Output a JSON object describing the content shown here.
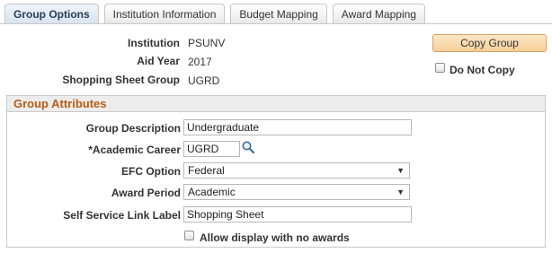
{
  "tabs": [
    {
      "label": "Group Options",
      "active": true
    },
    {
      "label": "Institution Information",
      "active": false
    },
    {
      "label": "Budget Mapping",
      "active": false
    },
    {
      "label": "Award Mapping",
      "active": false
    }
  ],
  "header": {
    "institution_label": "Institution",
    "institution_value": "PSUNV",
    "aid_year_label": "Aid Year",
    "aid_year_value": "2017",
    "shopping_sheet_group_label": "Shopping Sheet Group",
    "shopping_sheet_group_value": "UGRD"
  },
  "actions": {
    "copy_group_label": "Copy Group",
    "do_not_copy_label": "Do Not Copy",
    "do_not_copy_checked": false
  },
  "group_attributes": {
    "title": "Group Attributes",
    "group_description_label": "Group Description",
    "group_description_value": "Undergraduate",
    "academic_career_label": "*Academic Career",
    "academic_career_value": "UGRD",
    "efc_option_label": "EFC Option",
    "efc_option_value": "Federal",
    "award_period_label": "Award Period",
    "award_period_value": "Academic",
    "self_service_link_label": "Self Service Link Label",
    "self_service_link_value": "Shopping Sheet",
    "allow_display_label": "Allow display with no awards",
    "allow_display_checked": false
  },
  "icons": {
    "lookup": "magnifier-icon",
    "dropdown": "chevron-down-icon"
  },
  "colors": {
    "section_title": "#b85c14",
    "copy_button_bg": "#f6cf98",
    "active_tab_bg": "#d6e3ef"
  }
}
